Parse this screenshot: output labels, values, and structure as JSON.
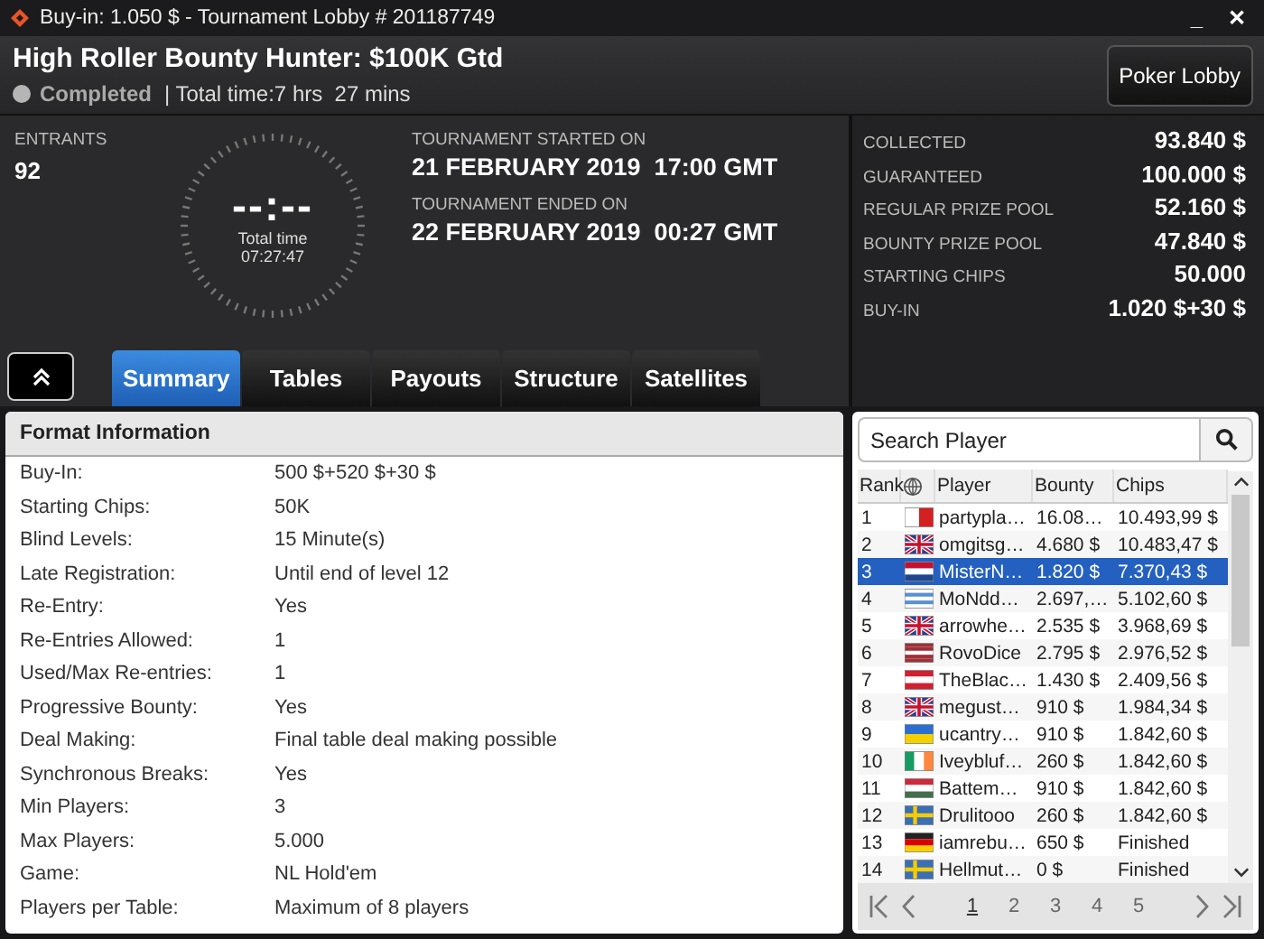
{
  "window": {
    "title": "Buy-in: 1.050 $ - Tournament Lobby # 201187749",
    "controls": [
      "_",
      "✕"
    ]
  },
  "header": {
    "title": "High Roller Bounty Hunter: $100K Gtd",
    "status": "Completed",
    "total_time": "| Total time:7 hrs  27 mins",
    "lobby_button": "Poker Lobby"
  },
  "entrants": {
    "label": "ENTRANTS",
    "value": "92"
  },
  "timer": {
    "display": "--:--",
    "label": "Total time",
    "value": "07:27:47"
  },
  "dates": [
    {
      "label": "TOURNAMENT STARTED ON",
      "value": "21 FEBRUARY 2019  17:00 GMT"
    },
    {
      "label": "TOURNAMENT ENDED ON",
      "value": "22 FEBRUARY 2019  00:27 GMT"
    }
  ],
  "stats": [
    {
      "label": "COLLECTED",
      "value": "93.840 $"
    },
    {
      "label": "GUARANTEED",
      "value": "100.000 $"
    },
    {
      "label": "REGULAR PRIZE POOL",
      "value": "52.160 $"
    },
    {
      "label": "BOUNTY PRIZE POOL",
      "value": "47.840 $"
    },
    {
      "label": "STARTING CHIPS",
      "value": "50.000"
    },
    {
      "label": "BUY-IN",
      "value": "1.020 $+30 $"
    }
  ],
  "tabs": [
    {
      "label": "Summary",
      "selected": true
    },
    {
      "label": "Tables",
      "selected": false
    },
    {
      "label": "Payouts",
      "selected": false
    },
    {
      "label": "Structure",
      "selected": false
    },
    {
      "label": "Satellites",
      "selected": false
    }
  ],
  "format": {
    "title": "Format Information",
    "rows": [
      {
        "label": "Buy-In:",
        "value": "500 $+520 $+30 $"
      },
      {
        "label": "Starting Chips:",
        "value": "50K"
      },
      {
        "label": "Blind Levels:",
        "value": "15 Minute(s)"
      },
      {
        "label": "Late Registration:",
        "value": "Until end of level 12"
      },
      {
        "label": "Re-Entry:",
        "value": "Yes"
      },
      {
        "label": "Re-Entries Allowed:",
        "value": "1"
      },
      {
        "label": "Used/Max Re-entries:",
        "value": "1"
      },
      {
        "label": "Progressive Bounty:",
        "value": "Yes"
      },
      {
        "label": "Deal Making:",
        "value": "Final table deal making possible"
      },
      {
        "label": "Synchronous Breaks:",
        "value": "Yes"
      },
      {
        "label": "Min Players:",
        "value": "3"
      },
      {
        "label": "Max Players:",
        "value": "5.000"
      },
      {
        "label": "Game:",
        "value": "NL Hold'em"
      },
      {
        "label": "Players per Table:",
        "value": "Maximum of 8 players"
      }
    ]
  },
  "players": {
    "search": {
      "placeholder": "Search Player"
    },
    "columns": [
      "Rank",
      "Player",
      "Bounty",
      "Chips"
    ],
    "rows": [
      {
        "rank": "1",
        "kind": "malta",
        "player": "partypla…",
        "bounty": "16.08…",
        "chips": "10.493,99 $",
        "selected": false
      },
      {
        "rank": "2",
        "kind": "uk",
        "player": "omgitsg…",
        "bounty": "4.680 $",
        "chips": "10.483,47 $",
        "selected": false
      },
      {
        "rank": "3",
        "kind": "netherlands",
        "player": "MisterN…",
        "bounty": "1.820 $",
        "chips": "7.370,43 $",
        "selected": true
      },
      {
        "rank": "4",
        "kind": "uruguay",
        "player": "MoNdd…",
        "bounty": "2.697,…",
        "chips": "5.102,60 $",
        "selected": false
      },
      {
        "rank": "5",
        "kind": "uk",
        "player": "arrowhe…",
        "bounty": "2.535 $",
        "chips": "3.968,69 $",
        "selected": false
      },
      {
        "rank": "6",
        "kind": "latvia",
        "player": "RovoDice",
        "bounty": "2.795 $",
        "chips": "2.976,52 $",
        "selected": false
      },
      {
        "rank": "7",
        "kind": "austria",
        "player": "TheBlac…",
        "bounty": "1.430 $",
        "chips": "2.409,56 $",
        "selected": false
      },
      {
        "rank": "8",
        "kind": "uk",
        "player": "megust…",
        "bounty": "910 $",
        "chips": "1.984,34 $",
        "selected": false
      },
      {
        "rank": "9",
        "kind": "ukraine",
        "player": "ucantry…",
        "bounty": "910 $",
        "chips": "1.842,60 $",
        "selected": false
      },
      {
        "rank": "10",
        "kind": "ireland",
        "player": "Iveybluf…",
        "bounty": "260 $",
        "chips": "1.842,60 $",
        "selected": false
      },
      {
        "rank": "11",
        "kind": "hungary",
        "player": "Battem…",
        "bounty": "910 $",
        "chips": "1.842,60 $",
        "selected": false
      },
      {
        "rank": "12",
        "kind": "sweden",
        "player": "Drulitooo",
        "bounty": "260 $",
        "chips": "1.842,60 $",
        "selected": false
      },
      {
        "rank": "13",
        "kind": "germany",
        "player": "iamrebu…",
        "bounty": "650 $",
        "chips": "Finished",
        "selected": false
      },
      {
        "rank": "14",
        "kind": "sweden",
        "player": "Hellmut…",
        "bounty": "0 $",
        "chips": "Finished",
        "selected": false
      }
    ],
    "pages": [
      {
        "label": "1",
        "selected": true
      },
      {
        "label": "2",
        "selected": false
      },
      {
        "label": "3",
        "selected": false
      },
      {
        "label": "4",
        "selected": false
      },
      {
        "label": "5",
        "selected": false
      }
    ]
  }
}
